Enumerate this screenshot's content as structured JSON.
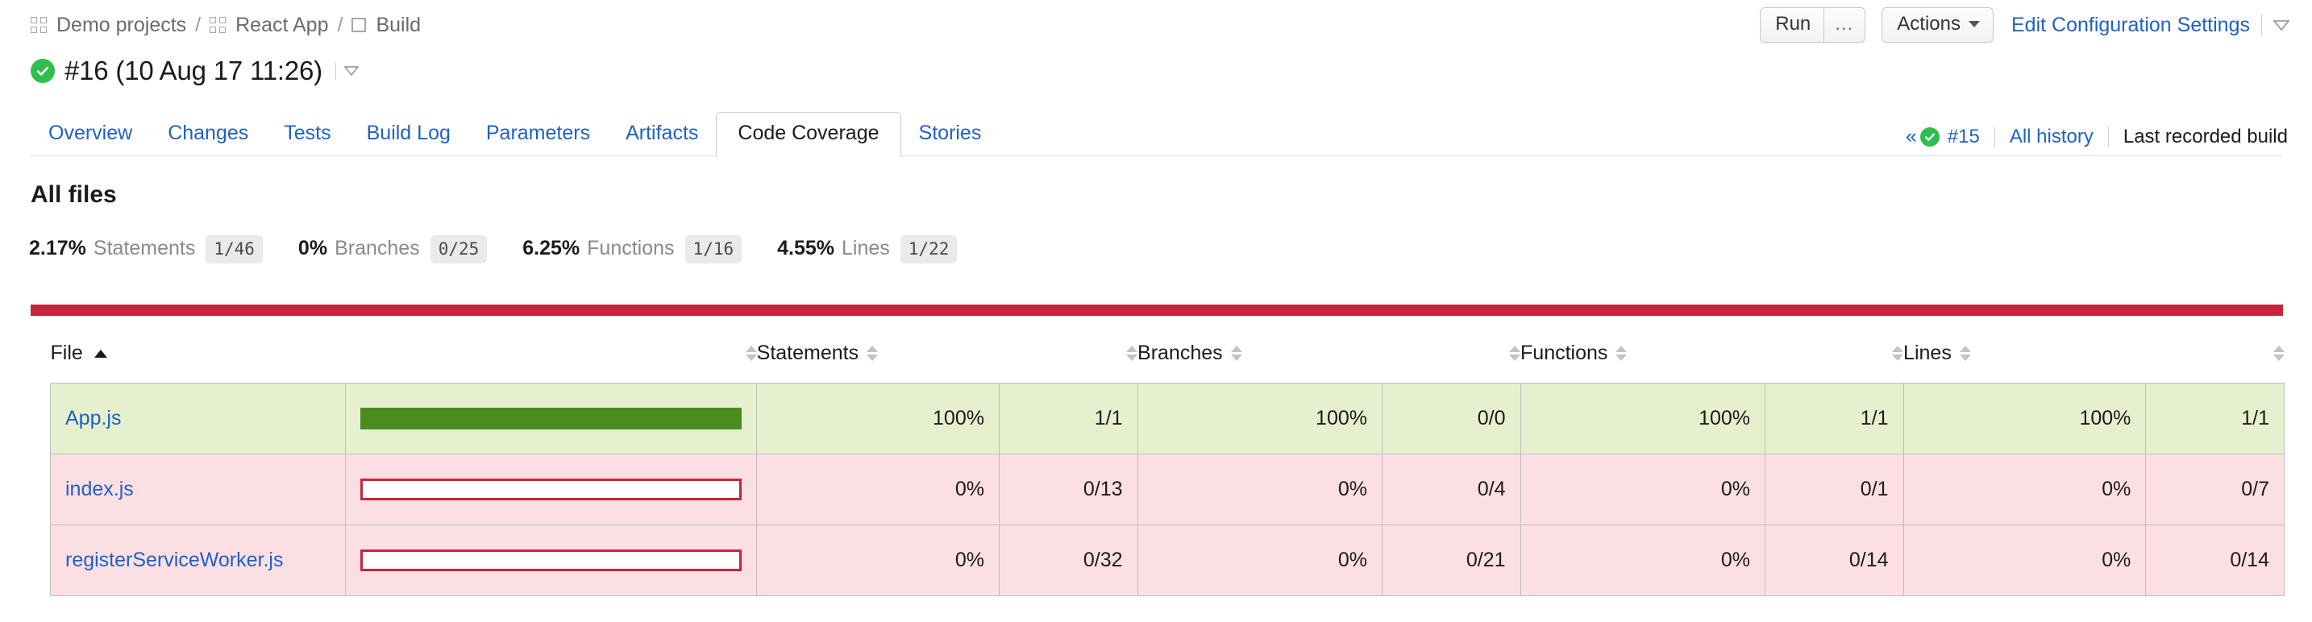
{
  "breadcrumb": {
    "items": [
      {
        "label": "Demo projects",
        "icon": "grid-icon"
      },
      {
        "label": "React App",
        "icon": "grid-icon"
      },
      {
        "label": "Build",
        "icon": "square-icon"
      }
    ],
    "separator": "/"
  },
  "top_actions": {
    "run_label": "Run",
    "run_more_label": "...",
    "actions_label": "Actions",
    "edit_config_label": "Edit Configuration Settings",
    "dropdown_icon": "chevron-down-icon"
  },
  "build": {
    "status_icon": "success-check-icon",
    "title": "#16 (10 Aug 17 11:26)",
    "dropdown_icon": "chevron-down-icon"
  },
  "tabs": {
    "items": [
      {
        "label": "Overview",
        "active": false
      },
      {
        "label": "Changes",
        "active": false
      },
      {
        "label": "Tests",
        "active": false
      },
      {
        "label": "Build Log",
        "active": false
      },
      {
        "label": "Parameters",
        "active": false
      },
      {
        "label": "Artifacts",
        "active": false
      },
      {
        "label": "Code Coverage",
        "active": true
      },
      {
        "label": "Stories",
        "active": false
      }
    ],
    "right": {
      "prev_arrows": "«",
      "prev_status_icon": "success-check-icon",
      "prev_build": "#15",
      "all_history": "All history",
      "last_recorded": "Last recorded build"
    }
  },
  "summary": {
    "title": "All files",
    "metrics": [
      {
        "percent": "2.17%",
        "name": "Statements",
        "fraction": "1/46"
      },
      {
        "percent": "0%",
        "name": "Branches",
        "fraction": "0/25"
      },
      {
        "percent": "6.25%",
        "name": "Functions",
        "fraction": "1/16"
      },
      {
        "percent": "4.55%",
        "name": "Lines",
        "fraction": "1/22"
      }
    ]
  },
  "colors": {
    "accent_red": "#c6253b",
    "link_blue": "#1f62c4",
    "success_green": "#2fbf4f",
    "bar_green": "#4a8b22",
    "row_good_bg": "#e6f0cf",
    "row_bad_bg": "#fbdfe3"
  },
  "table": {
    "headers": [
      {
        "label": "File",
        "sort": "asc"
      },
      {
        "label": "",
        "sort": "none"
      },
      {
        "label": "Statements",
        "sort": "none"
      },
      {
        "label": "",
        "sort": "none"
      },
      {
        "label": "Branches",
        "sort": "none"
      },
      {
        "label": "",
        "sort": "none"
      },
      {
        "label": "Functions",
        "sort": "none"
      },
      {
        "label": "",
        "sort": "none"
      },
      {
        "label": "Lines",
        "sort": "none"
      },
      {
        "label": "",
        "sort": "none"
      }
    ],
    "rows": [
      {
        "file": "App.js",
        "status": "good",
        "bar_percent": 100,
        "statements_pct": "100%",
        "statements_frac": "1/1",
        "branches_pct": "100%",
        "branches_frac": "0/0",
        "functions_pct": "100%",
        "functions_frac": "1/1",
        "lines_pct": "100%",
        "lines_frac": "1/1"
      },
      {
        "file": "index.js",
        "status": "bad",
        "bar_percent": 0,
        "statements_pct": "0%",
        "statements_frac": "0/13",
        "branches_pct": "0%",
        "branches_frac": "0/4",
        "functions_pct": "0%",
        "functions_frac": "0/1",
        "lines_pct": "0%",
        "lines_frac": "0/7"
      },
      {
        "file": "registerServiceWorker.js",
        "status": "bad",
        "bar_percent": 0,
        "statements_pct": "0%",
        "statements_frac": "0/32",
        "branches_pct": "0%",
        "branches_frac": "0/21",
        "functions_pct": "0%",
        "functions_frac": "0/14",
        "lines_pct": "0%",
        "lines_frac": "0/14"
      }
    ]
  }
}
